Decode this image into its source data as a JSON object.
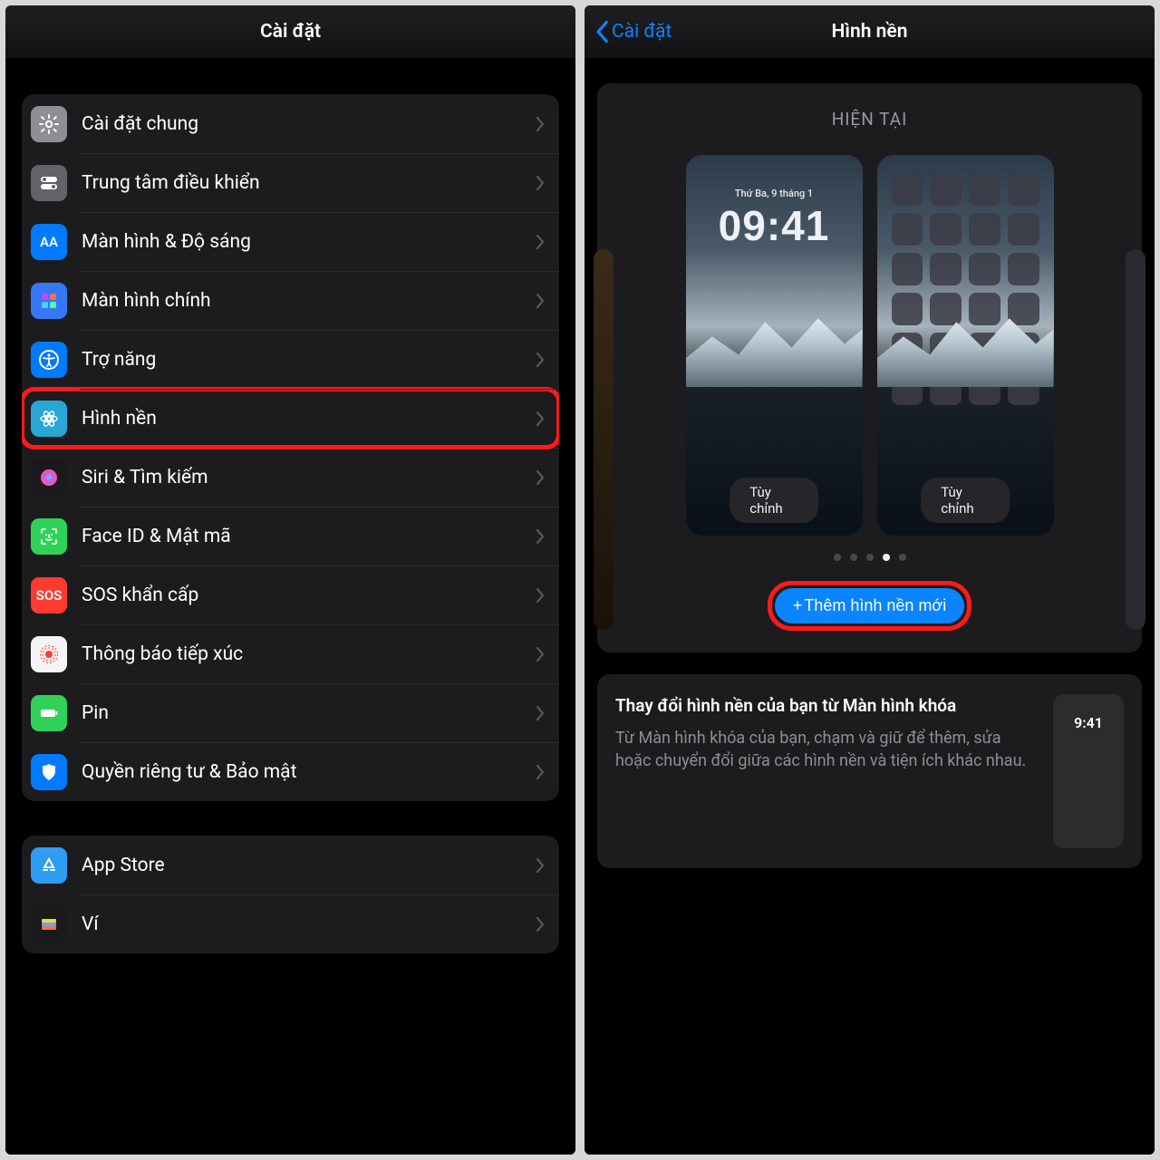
{
  "left": {
    "title": "Cài đặt",
    "groups": [
      {
        "rows": [
          {
            "icon": "gear-icon",
            "bg": "bg-gray",
            "label": "Cài đặt chung"
          },
          {
            "icon": "toggles-icon",
            "bg": "bg-gray2",
            "label": "Trung tâm điều khiển"
          },
          {
            "icon": "text-size-icon",
            "bg": "bg-blue",
            "label": "Màn hình & Độ sáng",
            "iconText": "AA"
          },
          {
            "icon": "home-screen-icon",
            "bg": "bg-indigo",
            "label": "Màn hình chính"
          },
          {
            "icon": "accessibility-icon",
            "bg": "bg-blue",
            "label": "Trợ năng"
          },
          {
            "icon": "wallpaper-icon",
            "bg": "bg-teal",
            "label": "Hình nền",
            "highlighted": true
          },
          {
            "icon": "siri-icon",
            "bg": "bg-black",
            "label": "Siri & Tìm kiếm"
          },
          {
            "icon": "faceid-icon",
            "bg": "bg-green",
            "label": "Face ID & Mật mã"
          },
          {
            "icon": "sos-icon",
            "bg": "bg-red",
            "label": "SOS khẩn cấp",
            "iconText": "SOS"
          },
          {
            "icon": "exposure-icon",
            "bg": "bg-white",
            "label": "Thông báo tiếp xúc"
          },
          {
            "icon": "battery-icon",
            "bg": "bg-green",
            "label": "Pin"
          },
          {
            "icon": "privacy-icon",
            "bg": "bg-blue",
            "label": "Quyền riêng tư & Bảo mật"
          }
        ]
      },
      {
        "rows": [
          {
            "icon": "appstore-icon",
            "bg": "bg-lightblue",
            "label": "App Store"
          },
          {
            "icon": "wallet-icon",
            "bg": "bg-black",
            "label": "Ví"
          }
        ]
      }
    ]
  },
  "right": {
    "back": "Cài đặt",
    "title": "Hình nền",
    "section": "HIỆN TẠI",
    "lock_date": "Thứ Ba, 9 tháng 1",
    "lock_time": "09:41",
    "customize": "Tùy chỉnh",
    "page_dots": {
      "count": 5,
      "active": 3
    },
    "add_button": "Thêm hình nền mới",
    "info": {
      "title": "Thay đổi hình nền của bạn từ Màn hình khóa",
      "desc": "Từ Màn hình khóa của bạn, chạm và giữ để thêm, sửa hoặc chuyển đổi giữa các hình nền và tiện ích khác nhau.",
      "thumb_time": "9:41"
    }
  }
}
